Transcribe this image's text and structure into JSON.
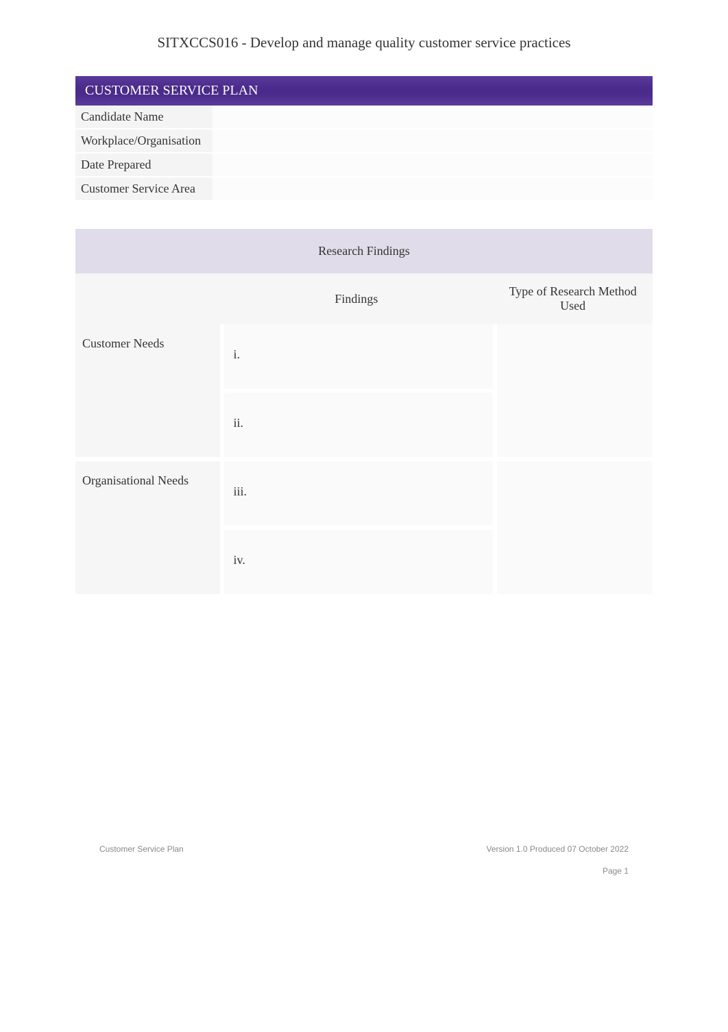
{
  "doc_title": "SITXCCS016 - Develop and manage quality customer service practices",
  "section_header": "CUSTOMER SERVICE PLAN",
  "info_fields": {
    "candidate_name_label": "Candidate Name",
    "candidate_name_value": "",
    "workplace_label": "Workplace/Organisation",
    "workplace_value": "",
    "date_label": "Date Prepared",
    "date_value": "",
    "area_label": "Customer Service Area",
    "area_value": ""
  },
  "findings": {
    "title": "Research Findings",
    "col_findings": "Findings",
    "col_method": "Type of Research Method Used",
    "rows": [
      {
        "label": "Customer Needs",
        "items": [
          "i.",
          "ii."
        ],
        "method": ""
      },
      {
        "label": "Organisational Needs",
        "items": [
          "iii.",
          "iv."
        ],
        "method": ""
      }
    ]
  },
  "footer": {
    "left": "Customer Service Plan",
    "right": "Version 1.0 Produced 07 October 2022",
    "page": "Page 1"
  }
}
